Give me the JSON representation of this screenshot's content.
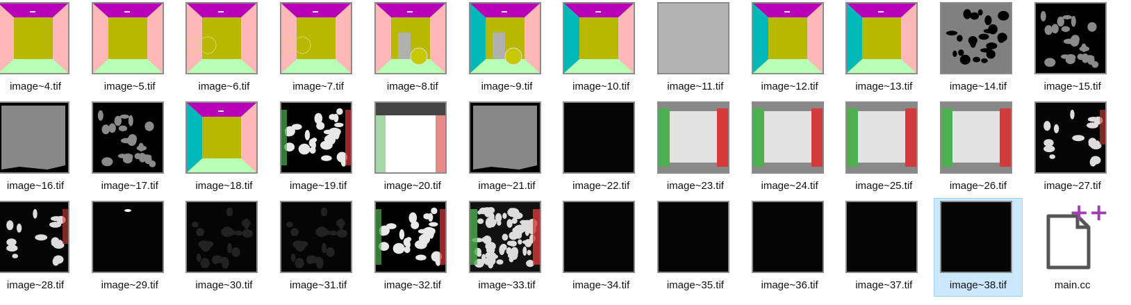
{
  "files": [
    {
      "name": "image~4.tif",
      "thumb": "room"
    },
    {
      "name": "image~5.tif",
      "thumb": "room"
    },
    {
      "name": "image~6.tif",
      "thumb": "room-ghost"
    },
    {
      "name": "image~7.tif",
      "thumb": "room-ghost"
    },
    {
      "name": "image~8.tif",
      "thumb": "room-objects"
    },
    {
      "name": "image~9.tif",
      "thumb": "room-objects-cyan"
    },
    {
      "name": "image~10.tif",
      "thumb": "room-cyan"
    },
    {
      "name": "image~11.tif",
      "thumb": "flat-gray"
    },
    {
      "name": "image~12.tif",
      "thumb": "room-cyan"
    },
    {
      "name": "image~13.tif",
      "thumb": "room-cyan"
    },
    {
      "name": "image~14.tif",
      "thumb": "gray-blobs"
    },
    {
      "name": "image~15.tif",
      "thumb": "black-gray-blobs"
    },
    {
      "name": "image~16.tif",
      "thumb": "gray-mask"
    },
    {
      "name": "image~17.tif",
      "thumb": "black-gray-blobs"
    },
    {
      "name": "image~18.tif",
      "thumb": "room-cyan"
    },
    {
      "name": "image~19.tif",
      "thumb": "black-white-blobs"
    },
    {
      "name": "image~20.tif",
      "thumb": "white-scene"
    },
    {
      "name": "image~21.tif",
      "thumb": "gray-mask"
    },
    {
      "name": "image~22.tif",
      "thumb": "near-black"
    },
    {
      "name": "image~23.tif",
      "thumb": "gray-white-scene"
    },
    {
      "name": "image~24.tif",
      "thumb": "gray-white-scene"
    },
    {
      "name": "image~25.tif",
      "thumb": "gray-white-scene"
    },
    {
      "name": "image~26.tif",
      "thumb": "gray-white-scene"
    },
    {
      "name": "image~27.tif",
      "thumb": "dark-scene"
    },
    {
      "name": "image~28.tif",
      "thumb": "dark-scene"
    },
    {
      "name": "image~29.tif",
      "thumb": "near-black-light"
    },
    {
      "name": "image~30.tif",
      "thumb": "dark-faint"
    },
    {
      "name": "image~31.tif",
      "thumb": "dark-faint"
    },
    {
      "name": "image~32.tif",
      "thumb": "black-white-blobs"
    },
    {
      "name": "image~33.tif",
      "thumb": "dense-blobs"
    },
    {
      "name": "image~34.tif",
      "thumb": "near-black"
    },
    {
      "name": "image~35.tif",
      "thumb": "near-black"
    },
    {
      "name": "image~36.tif",
      "thumb": "near-black"
    },
    {
      "name": "image~37.tif",
      "thumb": "near-black"
    },
    {
      "name": "image~38.tif",
      "thumb": "near-black",
      "selected": true
    },
    {
      "name": "main.cc",
      "thumb": "cc-file"
    }
  ],
  "colors": {
    "magenta": "#b800b8",
    "olive": "#b8b800",
    "pink": "#ffb8b8",
    "cyan": "#00b8b8",
    "lightgreen": "#b8ffb8",
    "selection": "#cce8ff",
    "green_wall": "#4caf50",
    "red_wall": "#d43a3a",
    "cc_plus": "#a040b0"
  }
}
